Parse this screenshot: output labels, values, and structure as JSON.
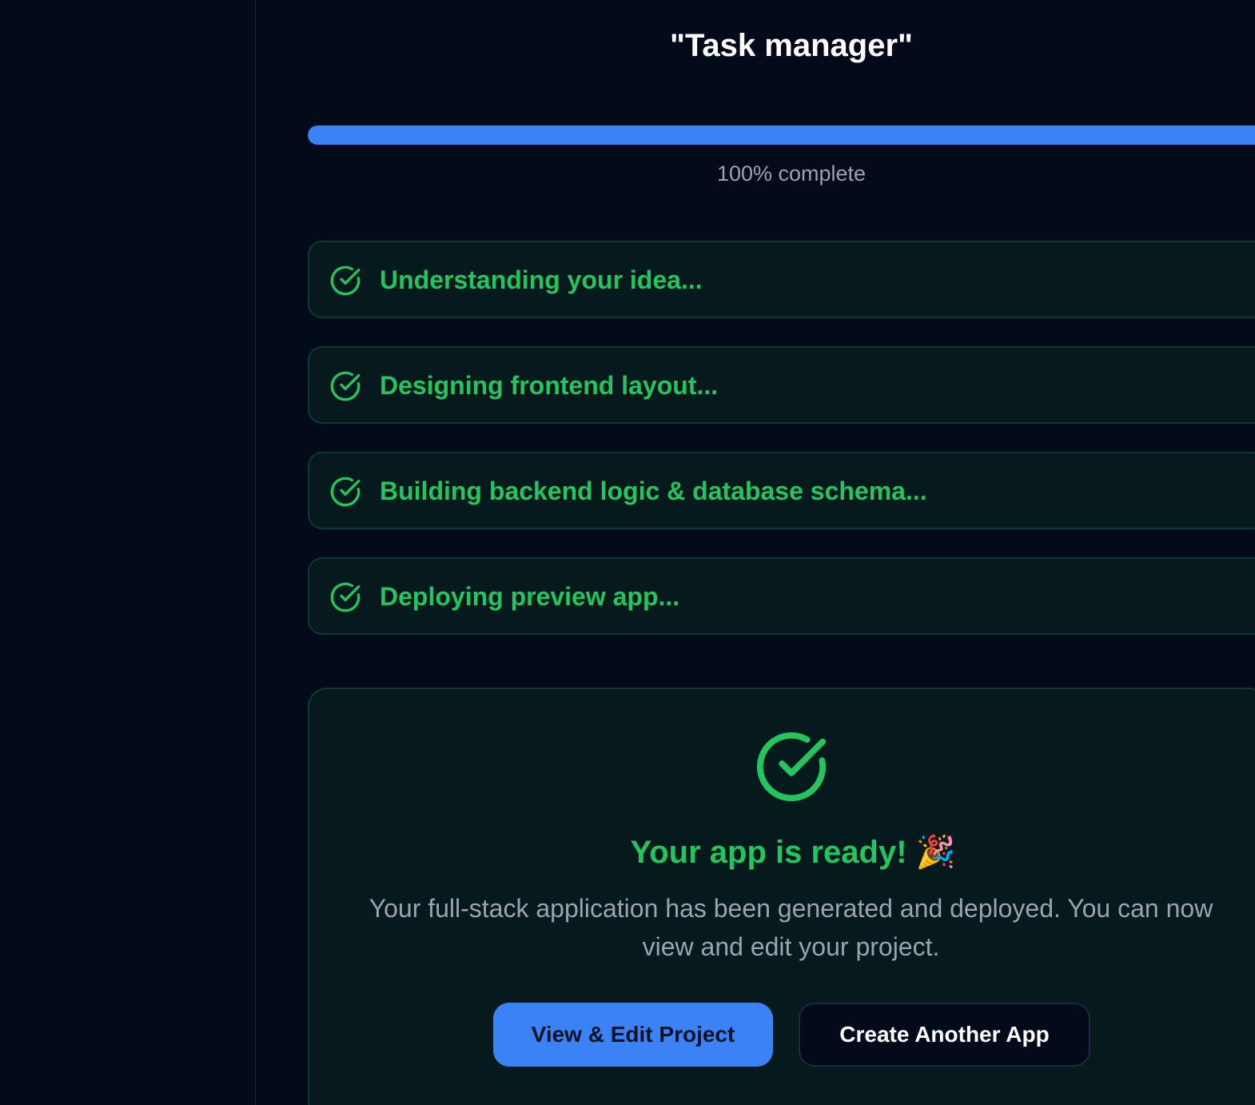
{
  "header": {
    "title": "\"Task manager\""
  },
  "progress": {
    "percent": 100,
    "label": "100% complete"
  },
  "steps": [
    {
      "label": "Understanding your idea...",
      "status": "done",
      "icon": "check-circle-icon"
    },
    {
      "label": "Designing frontend layout...",
      "status": "done",
      "icon": "check-circle-icon"
    },
    {
      "label": "Building backend logic & database schema...",
      "status": "done",
      "icon": "check-circle-icon"
    },
    {
      "label": "Deploying preview app...",
      "status": "done",
      "icon": "check-circle-icon"
    }
  ],
  "result": {
    "icon": "check-circle-icon",
    "title": "Your app is ready! 🎉",
    "description": "Your full-stack application has been generated and deployed. You can now view and edit your project.",
    "primary_button": "View & Edit Project",
    "secondary_button": "Create Another App"
  },
  "colors": {
    "background": "#030a19",
    "accent": "#3b82f6",
    "success": "#22c55e",
    "muted_text": "#9ca3af"
  }
}
